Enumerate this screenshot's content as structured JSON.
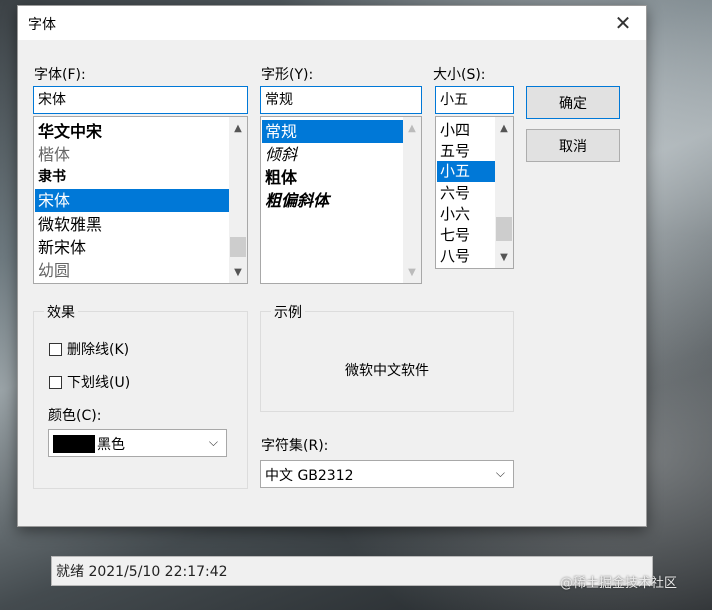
{
  "status_bar": {
    "text": "就绪   2021/5/10 22:17:42"
  },
  "watermark": "@稀土掘金技术社区",
  "dialog": {
    "title": "字体",
    "close": "✕",
    "font": {
      "label": "字体(F):",
      "value": "宋体",
      "items": [
        "华文中宋",
        "楷体",
        "隶书",
        "宋体",
        "微软雅黑",
        "新宋体",
        "幼圆"
      ],
      "selected": "宋体"
    },
    "style": {
      "label": "字形(Y):",
      "value": "常规",
      "items": [
        "常规",
        "倾斜",
        "粗体",
        "粗偏斜体"
      ],
      "selected": "常规"
    },
    "size": {
      "label": "大小(S):",
      "value": "小五",
      "items": [
        "小四",
        "五号",
        "小五",
        "六号",
        "小六",
        "七号",
        "八号"
      ],
      "selected": "小五"
    },
    "buttons": {
      "ok": "确定",
      "cancel": "取消"
    },
    "effects": {
      "title": "效果",
      "strikeout": "删除线(K)",
      "underline": "下划线(U)",
      "color_label": "颜色(C):",
      "color_value": "黑色",
      "color_swatch": "#000000"
    },
    "sample": {
      "title": "示例",
      "text": "微软中文软件"
    },
    "charset": {
      "label": "字符集(R):",
      "value": "中文 GB2312"
    }
  },
  "colors": {
    "accent": "#0078d7",
    "dialog_bg": "#f0f0f0"
  },
  "icons": {
    "close": "close-icon",
    "scroll_up": "chevron-up-icon",
    "scroll_down": "chevron-down-icon",
    "dropdown": "chevron-down-icon"
  }
}
